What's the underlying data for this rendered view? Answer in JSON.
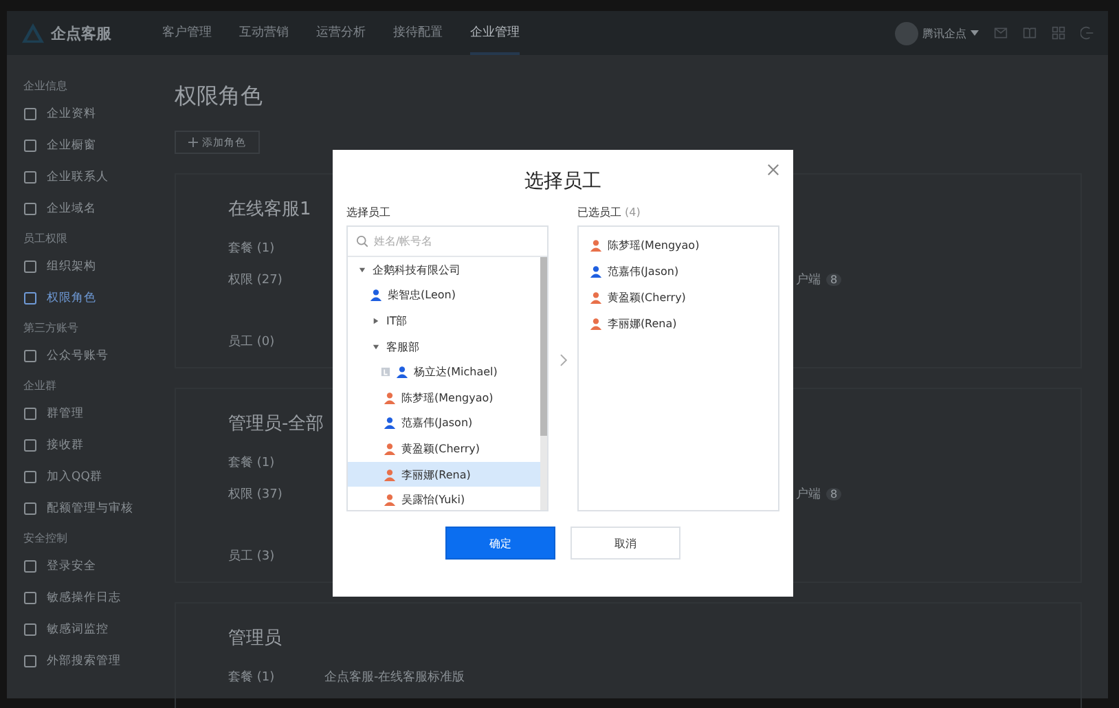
{
  "header": {
    "brand": "企点客服",
    "nav": [
      {
        "label": "客户管理",
        "selected": false
      },
      {
        "label": "互动营销",
        "selected": false
      },
      {
        "label": "运营分析",
        "selected": false
      },
      {
        "label": "接待配置",
        "selected": false
      },
      {
        "label": "企业管理",
        "selected": true
      }
    ],
    "account": "腾讯企点"
  },
  "sidebar": [
    {
      "group": "企业信息",
      "items": [
        {
          "label": "企业资料",
          "selected": false
        },
        {
          "label": "企业橱窗",
          "selected": false
        },
        {
          "label": "企业联系人",
          "selected": false
        },
        {
          "label": "企业域名",
          "selected": false
        }
      ]
    },
    {
      "group": "员工权限",
      "items": [
        {
          "label": "组织架构",
          "selected": false
        },
        {
          "label": "权限角色",
          "selected": true
        }
      ]
    },
    {
      "group": "第三方账号",
      "items": [
        {
          "label": "公众号账号",
          "selected": false
        }
      ]
    },
    {
      "group": "企业群",
      "items": [
        {
          "label": "群管理",
          "selected": false
        },
        {
          "label": "接收群",
          "selected": false
        },
        {
          "label": "加入QQ群",
          "selected": false
        },
        {
          "label": "配额管理与审核",
          "selected": false
        }
      ]
    },
    {
      "group": "安全控制",
      "items": [
        {
          "label": "登录安全",
          "selected": false
        },
        {
          "label": "敏感操作日志",
          "selected": false
        },
        {
          "label": "敏感词监控",
          "selected": false
        },
        {
          "label": "外部搜索管理",
          "selected": false
        }
      ]
    }
  ],
  "page": {
    "title": "权限角色",
    "add_button": "添加角色",
    "roles": [
      {
        "title": "在线客服1",
        "rows": [
          {
            "label": "套餐 (1)"
          },
          {
            "label": "权限 (27)",
            "extra": {
              "text": "户端",
              "badge": "8"
            }
          },
          {
            "label": "员工 (0)"
          }
        ]
      },
      {
        "title": "管理员-全部",
        "rows": [
          {
            "label": "套餐 (1)"
          },
          {
            "label": "权限 (37)",
            "extra": {
              "text": "户端",
              "badge": "8"
            }
          },
          {
            "label": "员工 (3)"
          }
        ]
      },
      {
        "title": "管理员",
        "rows": [
          {
            "label": "套餐 (1)",
            "value": "企点客服-在线客服标准版"
          }
        ]
      }
    ]
  },
  "dialog": {
    "title": "选择员工",
    "left_label": "选择员工",
    "search": {
      "placeholder": "姓名/帐号名"
    },
    "tree": [
      {
        "kind": "group",
        "label": "企鹅科技有限公司",
        "expanded": true,
        "children": [
          {
            "kind": "person",
            "label": "柴智忠(Leon)",
            "color": "#1f5fe0",
            "manager": false,
            "selected": false
          },
          {
            "kind": "group",
            "label": "IT部",
            "expanded": false
          },
          {
            "kind": "group",
            "label": "客服部",
            "expanded": true,
            "children": [
              {
                "kind": "person",
                "label": "杨立达(Michael)",
                "color": "#1f5fe0",
                "manager": true,
                "selected": false
              },
              {
                "kind": "person",
                "label": "陈梦瑶(Mengyao)",
                "color": "#e8704a",
                "manager": false,
                "selected": false
              },
              {
                "kind": "person",
                "label": "范嘉伟(Jason)",
                "color": "#1f5fe0",
                "manager": false,
                "selected": false
              },
              {
                "kind": "person",
                "label": "黄盈颖(Cherry)",
                "color": "#e8704a",
                "manager": false,
                "selected": false
              },
              {
                "kind": "person",
                "label": "李丽娜(Rena)",
                "color": "#e8704a",
                "manager": false,
                "selected": true
              },
              {
                "kind": "person",
                "label": "吴露怡(Yuki)",
                "color": "#e8704a",
                "manager": false,
                "selected": false
              }
            ]
          }
        ]
      }
    ],
    "right_label": "已选员工",
    "right_count": "(4)",
    "chosen": [
      {
        "label": "陈梦瑶(Mengyao)",
        "color": "#e8704a"
      },
      {
        "label": "范嘉伟(Jason)",
        "color": "#1f5fe0"
      },
      {
        "label": "黄盈颖(Cherry)",
        "color": "#e8704a"
      },
      {
        "label": "李丽娜(Rena)",
        "color": "#e8704a"
      }
    ],
    "ok": "确定",
    "cancel": "取消"
  }
}
